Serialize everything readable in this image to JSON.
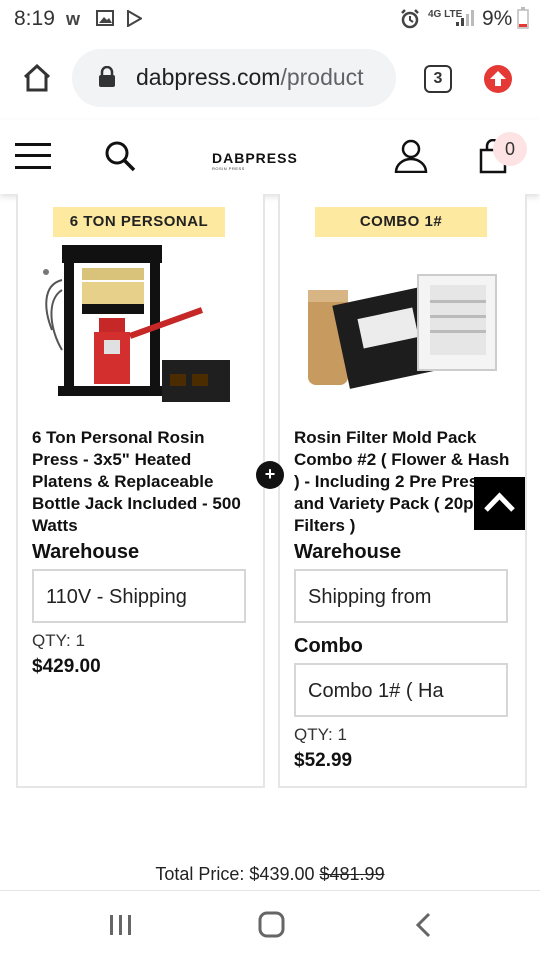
{
  "status_bar": {
    "time": "8:19",
    "battery_pct": "9%",
    "network": "4G LTE"
  },
  "browser": {
    "url_domain": "dabpress.com",
    "url_path": "/product",
    "tab_count": "3"
  },
  "site_header": {
    "logo_text": "DABPRESS",
    "logo_tagline": "ROSIN PRESS",
    "cart_count": "0"
  },
  "products": [
    {
      "tag": "6 TON PERSONAL",
      "title": "6 Ton Personal Rosin Press - 3x5\" Heated Platens & Replaceable Bottle Jack Included - 500 Watts",
      "warehouse_label": "Warehouse",
      "warehouse_value": "110V - Shipping",
      "qty": "QTY: 1",
      "price": "$429.00"
    },
    {
      "tag": "COMBO 1#",
      "title": "Rosin Filter Mold Pack Combo #2 ( Flower & Hash ) - Including 2 Pre Press and Variety Pack ( 20pc Filters )",
      "warehouse_label": "Warehouse",
      "warehouse_value": "Shipping from",
      "combo_label": "Combo",
      "combo_value": "Combo 1# ( Ha",
      "qty": "QTY: 1",
      "price": "$52.99"
    }
  ],
  "totals": {
    "label": "Total Price: $439.00",
    "original": "$481.99"
  },
  "colors": {
    "tag_bg": "#fde9a0",
    "update_red": "#e53935",
    "cart_badge_bg": "#fde3e3"
  }
}
